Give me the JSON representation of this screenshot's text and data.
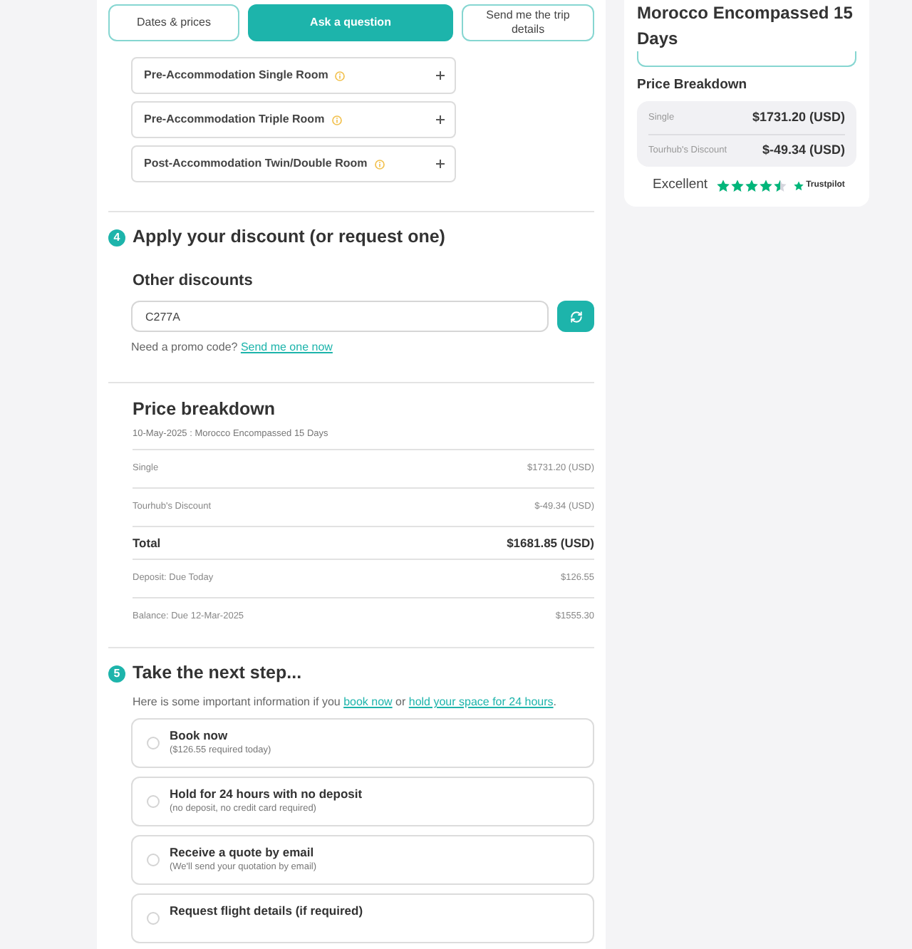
{
  "tabs": [
    {
      "label": "Dates & prices",
      "selected": false
    },
    {
      "label": "Ask a question",
      "selected": true
    },
    {
      "label": "Send me the trip details",
      "selected": false
    }
  ],
  "room_options": [
    {
      "title": "Pre-Accommodation Single Room",
      "expanded": false
    },
    {
      "title": "Pre-Accommodation Triple Room",
      "expanded": false
    },
    {
      "title": "Post-Accommodation Twin/Double Room",
      "expanded": false
    }
  ],
  "discount": {
    "step": "4",
    "title": "Apply your discount (or request one)",
    "label": "Other discounts",
    "code_field": {
      "value": "C277A"
    },
    "hint": "Need a promo code? ",
    "hint_link": "Send me one now"
  },
  "price_breakdown": {
    "title": "Price breakdown",
    "subtitle": "10-May-2025 : Morocco Encompassed 15 Days",
    "rows": [
      {
        "kind": "item",
        "label": "Single",
        "value": "$1731.20 (USD)"
      },
      {
        "kind": "item",
        "label": "Tourhub's Discount",
        "value": "$-49.34 (USD)"
      },
      {
        "kind": "total",
        "label": "Total",
        "value": "$1681.85 (USD)"
      },
      {
        "kind": "item",
        "label": "Deposit: Due Today",
        "value": "$126.55"
      },
      {
        "kind": "item",
        "label": "Balance: Due 12-Mar-2025",
        "value": "$1555.30"
      }
    ]
  },
  "next_step": {
    "step": "5",
    "title": "Take the next step...",
    "intro": [
      {
        "kind": "text",
        "text": "Here is some important information if you "
      },
      {
        "kind": "link",
        "text": "book now"
      },
      {
        "kind": "text",
        "text": " or "
      },
      {
        "kind": "link",
        "text": "hold your space for 24 hours"
      },
      {
        "kind": "text",
        "text": "."
      }
    ],
    "options": [
      {
        "title": "Book now",
        "subtitle": "($126.55 required today)",
        "selected": false
      },
      {
        "title": "Hold for 24 hours with no deposit",
        "subtitle": "(no deposit, no credit card required)",
        "selected": false
      },
      {
        "title": "Receive a quote by email",
        "subtitle": "(We'll send your quotation by email)",
        "selected": false
      },
      {
        "title": "Request flight details (if required)",
        "selected": false
      }
    ]
  },
  "sidebar": {
    "title": "Morocco Encompassed 15 Days",
    "price_title": "Price Breakdown",
    "rows": [
      {
        "label": "Single",
        "value": "$1731.20 (USD)"
      },
      {
        "label": "Tourhub's Discount",
        "value": "$-49.34 (USD)"
      }
    ],
    "rating": {
      "label": "Excellent",
      "stars": 4.5,
      "brand": "Trustpilot"
    }
  }
}
